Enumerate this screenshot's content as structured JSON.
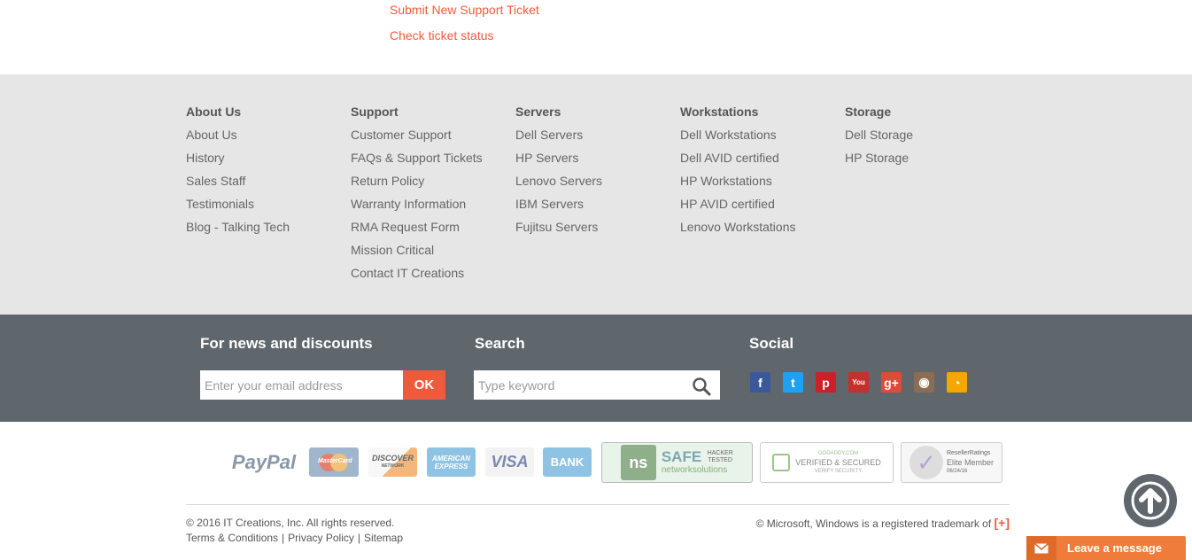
{
  "top_links": {
    "submit_ticket": "Submit New Support Ticket",
    "check_status": "Check ticket status"
  },
  "footer_nav": [
    {
      "heading": "About Us",
      "items": [
        "About Us",
        "History",
        "Sales Staff",
        "Testimonials",
        "Blog - Talking Tech"
      ]
    },
    {
      "heading": "Support",
      "items": [
        "Customer Support",
        "FAQs & Support Tickets",
        "Return Policy",
        "Warranty Information",
        "RMA Request Form",
        "Mission Critical",
        "Contact IT Creations"
      ]
    },
    {
      "heading": "Servers",
      "items": [
        "Dell Servers",
        "HP Servers",
        "Lenovo Servers",
        "IBM Servers",
        "Fujitsu Servers"
      ]
    },
    {
      "heading": "Workstations",
      "items": [
        "Dell Workstations",
        "Dell AVID certified",
        "HP Workstations",
        "HP AVID certified",
        "Lenovo Workstations"
      ]
    },
    {
      "heading": "Storage",
      "items": [
        "Dell Storage",
        "HP Storage"
      ]
    }
  ],
  "newsletter": {
    "heading": "For news and discounts",
    "placeholder": "Enter your email address",
    "button": "OK"
  },
  "search": {
    "heading": "Search",
    "placeholder": "Type keyword"
  },
  "social": {
    "heading": "Social",
    "icons": [
      {
        "name": "facebook-icon",
        "glyph": "f",
        "color": "#3b5998"
      },
      {
        "name": "twitter-icon",
        "glyph": "t",
        "color": "#1da1f2"
      },
      {
        "name": "pinterest-icon",
        "glyph": "p",
        "color": "#cb2027"
      },
      {
        "name": "youtube-icon",
        "glyph": "You",
        "color": "#c4302b"
      },
      {
        "name": "google-plus-icon",
        "glyph": "g+",
        "color": "#dd4b39"
      },
      {
        "name": "instagram-icon",
        "glyph": "◉",
        "color": "#8a6d52"
      },
      {
        "name": "rss-icon",
        "glyph": "◔",
        "color": "#f7a600"
      }
    ]
  },
  "payments": {
    "paypal": "PayPal",
    "mastercard": "MasterCard",
    "discover": "DISCOVER",
    "discover_sub": "NETWORK",
    "amex": "AMERICAN EXPRESS",
    "visa": "VISA",
    "bank": "BANK",
    "safe_seal": "SAFE",
    "safe_tested": "HACKER TESTED",
    "safe_sub": "networksolutions",
    "godaddy_top": "GODADDY.COM",
    "godaddy": "VERIFIED & SECURED",
    "godaddy_sub": "VERIFY SECURITY",
    "reseller": "ResellerRatings",
    "reseller_member": "Elite Member",
    "reseller_date": "06/24/16"
  },
  "legal": {
    "copyright": "© 2016 IT Creations, Inc. All rights reserved.",
    "terms": "Terms & Conditions",
    "privacy": "Privacy Policy",
    "sitemap": "Sitemap",
    "separator": "|",
    "microsoft": "© Microsoft, Windows is a registered trademark of",
    "plus": "[+]"
  },
  "chat": {
    "label": "Leave a message"
  },
  "colors": {
    "accent": "#f05a3c",
    "band": "#5f676d",
    "nav_bg": "#e6e6e6",
    "chat": "#f07c3c"
  }
}
